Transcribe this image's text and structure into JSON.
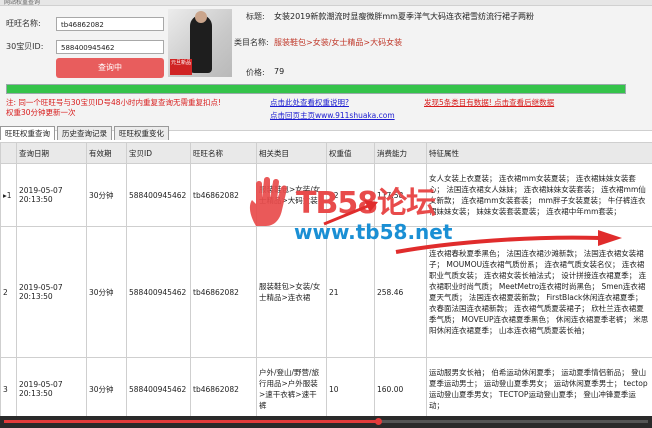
{
  "header": {
    "strip_title": "网站权重查询",
    "wangwang_label": "旺旺名称:",
    "wangwang_value": "tb46862082",
    "itemid_label": "宝贝ID:",
    "itemid_prefix": "30",
    "itemid_value": "588400945462",
    "query_button": "查询中"
  },
  "product": {
    "thumb_tag": "元旦新品",
    "title_label": "标题:",
    "title_value": "女装2019新款潮流时显瘦微胖mm夏季洋气大码连衣裙雪纺流行裙子两粉",
    "category_label": "类目名称:",
    "category_value": "服装鞋包>女装/女士精品>大码女装",
    "price_label": "价格:",
    "price_value": "79"
  },
  "progress": {
    "percent": 100,
    "color": "#34c34a"
  },
  "notices": {
    "line1": "注: 同一个旺旺号与30宝贝ID号48小时内重复查询无需重复扣点!",
    "line2": "权重30分钟更新一次",
    "link1": "点击此处查看权重说明?",
    "link2": "点击回页主页www.911shuaka.com",
    "link3": "发现5条类目有数据! 点击查看后继数据"
  },
  "tabs": [
    {
      "label": "旺旺权重查询",
      "active": true
    },
    {
      "label": "历史查询记录",
      "active": false
    },
    {
      "label": "旺旺权重变化",
      "active": false
    }
  ],
  "table": {
    "headers": [
      "",
      "查询日期",
      "有效期",
      "宝贝ID",
      "旺旺名称",
      "相关类目",
      "权重值",
      "消费能力",
      "特征属性"
    ],
    "rows": [
      {
        "no": "1",
        "date": "2019-05-07 20:13:50",
        "validity": "30分钟",
        "item_id": "588400945462",
        "wangwang": "tb46862082",
        "category": "服装鞋包>女装/女士精品>大码女装",
        "weight": "12",
        "spend": "117.58",
        "features": "女人女装上衣夏装； 连衣裙mm女装夏装； 连衣裙妹妹女装套心； 法国连衣裙女人妹妹； 连衣裙妹妹女装套装； 连衣裙mm仙女新款； 连衣裙mm女装套装； mm胖子女装夏装； 牛仔裤连衣裙妹妹女装； 妹妹女装套装夏装； 连衣裙中年mm套装；"
      },
      {
        "no": "2",
        "date": "2019-05-07 20:13:50",
        "validity": "30分钟",
        "item_id": "588400945462",
        "wangwang": "tb46862082",
        "category": "服装鞋包>女装/女士精品>连衣裙",
        "weight": "21",
        "spend": "258.46",
        "features": "连衣裙春秋夏季黑色； 法国连衣裙沙滩新款； 法国连衣裙女装裙子； MOUMOU连衣裙气质份系； 连衣裙气质女装名仪； 连衣裙职业气质女装； 连衣裙女装长袖法式； 设计拼接连衣裙夏季； 连衣裙职业时尚气质； MeetMetro连衣裙时尚黑色； Smen连衣裙夏天气质； 法国连衣裙夏装新款； FirstBlack休闲连衣裙夏季； 衣春面法国连衣裙新款； 连衣裙气质夏装裙子； 欣杜兰连衣裙夏季气质； MOVEUP连衣裙夏季黑色； 休闲连衣裙夏季老裤； 米思阳休闲连衣裙夏季； 山本连衣裙气质夏装长袖；"
      },
      {
        "no": "3",
        "date": "2019-05-07 20:13:50",
        "validity": "30分钟",
        "item_id": "588400945462",
        "wangwang": "tb46862082",
        "category": "户外/登山/野营/旅行用品>户外服装>速干衣裤>速干裤",
        "weight": "10",
        "spend": "160.00",
        "features": "运动服男女长袖； 伯希运动休闲夏季； 运动夏季情侣新品； 登山夏季运动男士； 运动登山夏季男女； 运动休闲夏季男士； tectop运动登山夏季男女； TECTOP运动登山夏季； 登山冲锋夏季运动；"
      }
    ]
  },
  "watermark": {
    "brand": "TB58论坛",
    "url": "www.tb58.net",
    "brand_color": "#e84b4b",
    "url_color": "#1a8fd4"
  },
  "video": {
    "played_fraction": 0.58
  }
}
